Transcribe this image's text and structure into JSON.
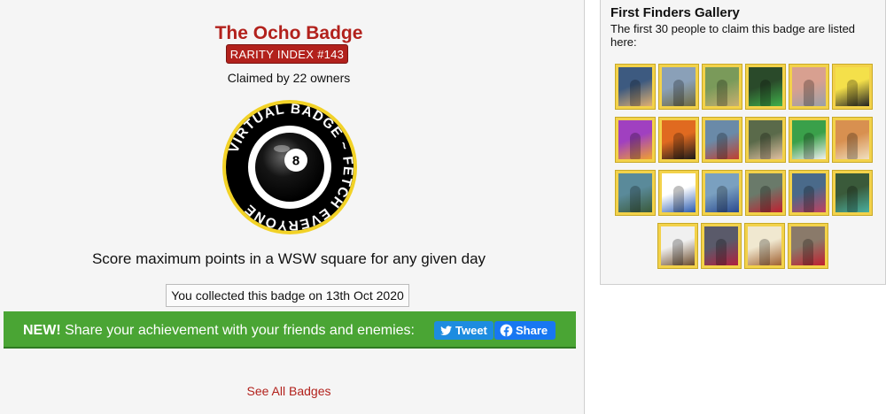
{
  "badge": {
    "title": "The Ocho Badge",
    "rarity": "RARITY INDEX #143",
    "claimed": "Claimed by 22 owners",
    "ring_text": "VIRTUAL BADGE ~ FETCH EVERYONE",
    "ball_number": "8",
    "description": "Score maximum points in a WSW square for any given day",
    "collected": "You collected this badge on 13th Oct 2020"
  },
  "share": {
    "new_label": "NEW!",
    "text": "Share your achievement with your friends and enemies:",
    "tweet_label": "Tweet",
    "share_label": "Share"
  },
  "links": {
    "see_all": "See All Badges"
  },
  "gallery": {
    "title": "First Finders Gallery",
    "subtitle": "The first 30 people to claim this badge are listed here:",
    "thumbs": [
      {
        "name": "finder-1",
        "c1": "#3d5a80",
        "c2": "#e0b070"
      },
      {
        "name": "finder-2",
        "c1": "#8aa0b8",
        "c2": "#6f6a40"
      },
      {
        "name": "finder-3",
        "c1": "#7a9a5a",
        "c2": "#c8b070"
      },
      {
        "name": "finder-4",
        "c1": "#2a4a2a",
        "c2": "#3fb04a"
      },
      {
        "name": "finder-5",
        "c1": "#d8a090",
        "c2": "#9aa0a8"
      },
      {
        "name": "finder-6",
        "c1": "#f4e04a",
        "c2": "#222222"
      },
      {
        "name": "finder-7",
        "c1": "#a040c0",
        "c2": "#f0a030"
      },
      {
        "name": "finder-8",
        "c1": "#e06a20",
        "c2": "#1a1a1a"
      },
      {
        "name": "finder-9",
        "c1": "#6a8aa8",
        "c2": "#c04030"
      },
      {
        "name": "finder-10",
        "c1": "#5a6a4a",
        "c2": "#e0c0a0"
      },
      {
        "name": "finder-11",
        "c1": "#3aa04a",
        "c2": "#f0f0f0"
      },
      {
        "name": "finder-12",
        "c1": "#d89050",
        "c2": "#f0e0c0"
      },
      {
        "name": "finder-13",
        "c1": "#5a8a9a",
        "c2": "#3a5a3a"
      },
      {
        "name": "finder-14",
        "c1": "#ffffff",
        "c2": "#2a5ab0"
      },
      {
        "name": "finder-15",
        "c1": "#7aa0c0",
        "c2": "#2a4a90"
      },
      {
        "name": "finder-16",
        "c1": "#6a7a6a",
        "c2": "#c02030"
      },
      {
        "name": "finder-17",
        "c1": "#4a6a8a",
        "c2": "#c04060"
      },
      {
        "name": "finder-18",
        "c1": "#3a5a3a",
        "c2": "#4ab0a0"
      },
      {
        "name": "finder-19",
        "c1": "#f0f0f0",
        "c2": "#6a4a2a"
      },
      {
        "name": "finder-20",
        "c1": "#5a5a6a",
        "c2": "#b02040"
      },
      {
        "name": "finder-21",
        "c1": "#f0e8d0",
        "c2": "#a06030"
      },
      {
        "name": "finder-22",
        "c1": "#8a7a6a",
        "c2": "#c02030"
      }
    ]
  },
  "icons": {
    "twitter": "twitter-bird-icon",
    "facebook": "facebook-icon"
  },
  "colors": {
    "accent": "#b2211c",
    "share_green": "#4aa534",
    "tweet_blue": "#1d8ce0",
    "facebook_blue": "#1877f2",
    "thumb_frame": "#f3d24a"
  }
}
